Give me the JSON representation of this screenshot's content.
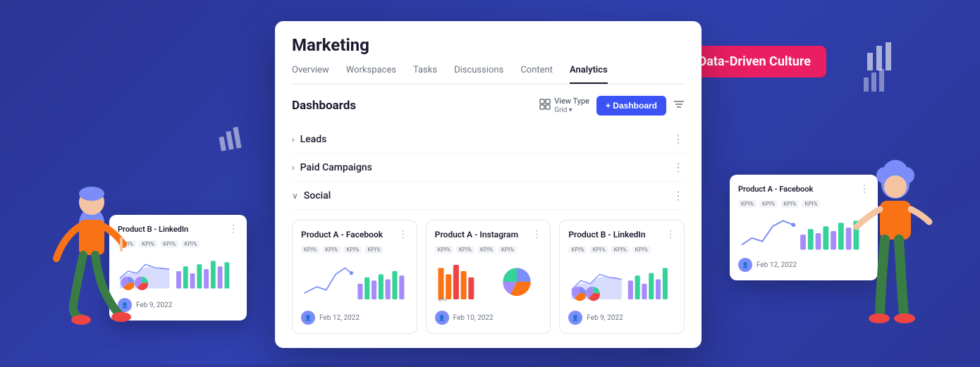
{
  "background": {
    "color": "#2d3a9e"
  },
  "badge": {
    "text": "Data-Driven Culture"
  },
  "main_card": {
    "title": "Marketing",
    "tabs": [
      {
        "label": "Overview",
        "active": false
      },
      {
        "label": "Workspaces",
        "active": false
      },
      {
        "label": "Tasks",
        "active": false
      },
      {
        "label": "Discussions",
        "active": false
      },
      {
        "label": "Content",
        "active": false
      },
      {
        "label": "Analytics",
        "active": true
      }
    ],
    "dashboards": {
      "title": "Dashboards",
      "view_type_label": "View Type",
      "view_type_sub": "Grid",
      "add_btn": "+ Dashboard",
      "accordion_rows": [
        {
          "label": "Leads",
          "expanded": false
        },
        {
          "label": "Paid Campaigns",
          "expanded": false
        },
        {
          "label": "Social",
          "expanded": true
        }
      ],
      "cards": [
        {
          "title": "Product A - Facebook",
          "kpis": [
            "KPI%",
            "KPI%",
            "KPI%",
            "KPI%"
          ],
          "date": "Feb 12, 2022",
          "chart_type": "line_bar"
        },
        {
          "title": "Product A - Instagram",
          "kpis": [
            "KPI%",
            "KPI%",
            "KPI%",
            "KPI%"
          ],
          "date": "Feb 10, 2022",
          "chart_type": "bar_pie"
        },
        {
          "title": "Product B - LinkedIn",
          "kpis": [
            "KPI%",
            "KPI%",
            "KPI%",
            "KPI%"
          ],
          "date": "Feb 9, 2022",
          "chart_type": "area_pie"
        }
      ]
    }
  },
  "floating_left": {
    "title": "Product B - LinkedIn",
    "kpis": [
      "KPI%",
      "KPI%",
      "KPI%",
      "KPI%"
    ],
    "date": "Feb 9, 2022"
  },
  "floating_right": {
    "title": "Product A - Facebook",
    "kpis": [
      "KPI%",
      "KPI%",
      "KPI%",
      "KPI%"
    ],
    "date": "Feb 12, 2022"
  }
}
